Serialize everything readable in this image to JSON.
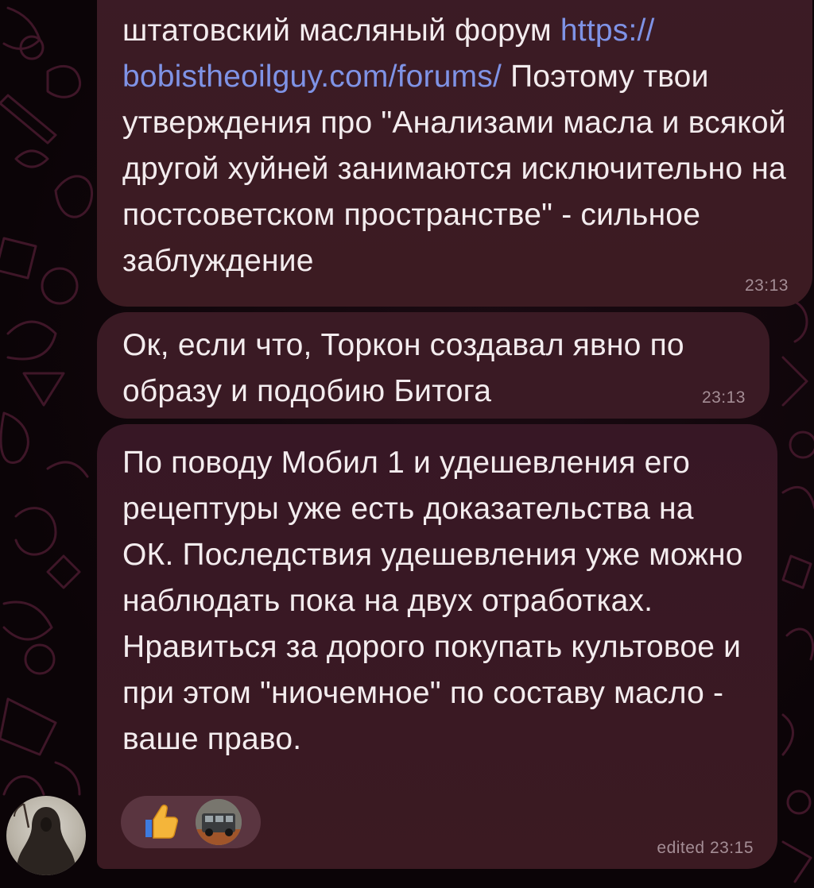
{
  "messages": [
    {
      "id": "msg1",
      "lines_before_link": "штатовский масляный форум ",
      "link_text": "https://\nbobistheoilguy.com/forums/",
      "text_after_link": " Поэтому твои утверждения про \"Анализами масла и всякой другой хуйней занимаются исключительно на постсоветском пространстве\" - сильное заблуждение",
      "time": "23:13"
    },
    {
      "id": "msg2",
      "text": "Ок, если что, Торкон создавал явно по образу и подобию Битога",
      "time": "23:13"
    },
    {
      "id": "msg3",
      "text": "По поводу Мобил 1 и удешевления его рецептуры уже есть доказательства на ОК. Последствия удешевления уже можно наблюдать пока на двух отработках. Нравиться за дорого покупать культовое и при этом \"ниочемное\" по составу масло - ваше право.",
      "time": "edited 23:15",
      "reactions": [
        {
          "icon": "thumbs-up-icon"
        },
        {
          "icon": "reactor-avatar-van"
        }
      ]
    }
  ],
  "colors": {
    "bubble": "#3a1a24",
    "link": "#7f93e6",
    "text": "#f3ecee",
    "time": "#a48d95",
    "wallpaper_line": "#4a1a30"
  }
}
